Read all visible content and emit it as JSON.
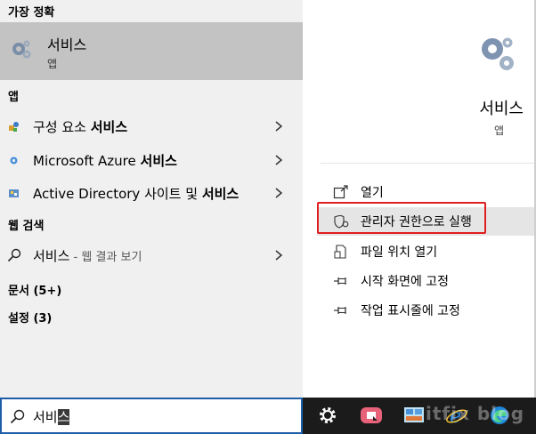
{
  "best_match": {
    "header": "가장 정확",
    "title": "서비스",
    "subtitle": "앱"
  },
  "apps": {
    "header": "앱",
    "items": [
      {
        "prefix": "구성 요소 ",
        "bold": "서비스"
      },
      {
        "prefix": "Microsoft Azure ",
        "bold": "서비스"
      },
      {
        "prefix": "Active Directory 사이트 및 ",
        "bold": "서비스"
      }
    ]
  },
  "web_search": {
    "header": "웹 검색",
    "query": "서비스",
    "suffix": " - 웹 결과 보기"
  },
  "documents": {
    "label": "문서 (5+)"
  },
  "settings": {
    "label": "설정 (3)"
  },
  "detail": {
    "title": "서비스",
    "subtitle": "앱",
    "actions": [
      {
        "label": "열기",
        "icon": "open-icon"
      },
      {
        "label": "관리자 권한으로 실행",
        "icon": "shield-icon"
      },
      {
        "label": "파일 위치 열기",
        "icon": "file-icon"
      },
      {
        "label": "시작 화면에 고정",
        "icon": "pin-icon"
      },
      {
        "label": "작업 표시줄에 고정",
        "icon": "pin-icon"
      }
    ]
  },
  "search": {
    "typed": "서비",
    "selected": "스"
  },
  "watermark": "itfix blog",
  "colors": {
    "highlight_box": "#e02020",
    "best_match_bg": "#c3c3c3",
    "taskbar_bg": "#1b1b1b",
    "search_border": "#1e5ea8"
  }
}
